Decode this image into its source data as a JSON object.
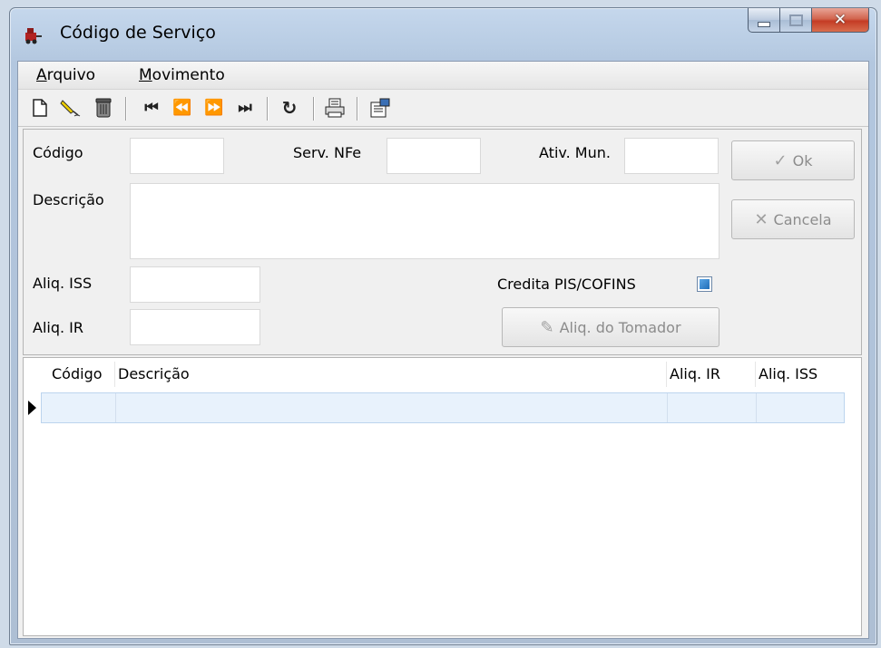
{
  "window": {
    "title": "Código de Serviço"
  },
  "menu": [
    {
      "label": "Arquivo",
      "accel": "A",
      "rest": "rquivo"
    },
    {
      "label": "Movimento",
      "accel": "M",
      "rest": "ovimento"
    }
  ],
  "toolbar": {
    "new_icon": "new-document-icon",
    "edit_icon": "pencil-edit-icon",
    "delete_icon": "trash-can-icon",
    "first_icon": "first-record-icon",
    "prev_icon": "previous-record-icon",
    "next_icon": "next-record-icon",
    "last_icon": "last-record-icon",
    "refresh_icon": "refresh-icon",
    "print_icon": "printer-icon",
    "properties_icon": "properties-icon"
  },
  "form": {
    "codigo_label": "Código",
    "codigo_value": "",
    "serv_nfe_label": "Serv. NFe",
    "serv_nfe_value": "",
    "ativ_mun_label": "Ativ. Mun.",
    "ativ_mun_value": "",
    "descricao_label": "Descrição",
    "descricao_value": "",
    "aliq_iss_label": "Aliq. ISS",
    "aliq_iss_value": "",
    "aliq_ir_label": "Aliq. IR",
    "aliq_ir_value": "",
    "credita_label": "Credita PIS/COFINS",
    "credita_checked": true,
    "ok_label": "Ok",
    "cancela_label": "Cancela",
    "tomador_label": "Aliq. do Tomador"
  },
  "grid": {
    "columns": [
      "Código",
      "Descrição",
      "Aliq. IR",
      "Aliq. ISS"
    ],
    "rows": [
      {
        "codigo": "",
        "descricao": "",
        "aliq_ir": "",
        "aliq_iss": ""
      }
    ]
  }
}
